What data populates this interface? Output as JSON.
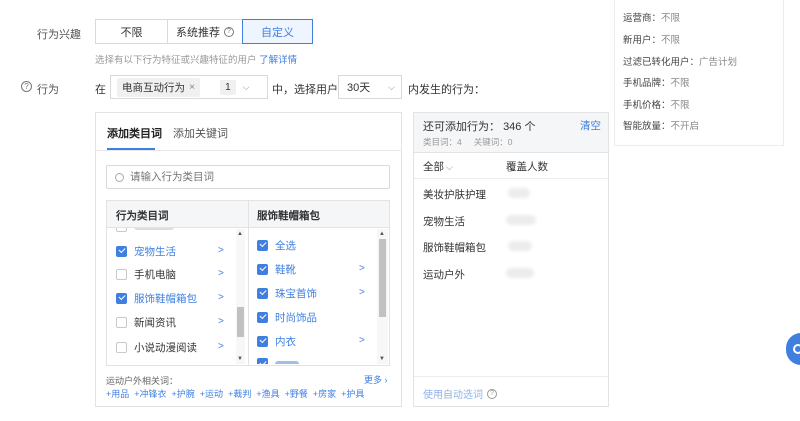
{
  "interest": {
    "label": "行为兴趣",
    "options": [
      "不限",
      "系统推荐",
      "自定义"
    ],
    "selected": "自定义",
    "hint": "选择有以下行为特征或兴趣特征的用户",
    "hint_link": "了解详情"
  },
  "behavior": {
    "label": "行为",
    "prefix": "在",
    "scene_tag": "电商互动行为",
    "count": "1",
    "mid_text": "中，选择用户",
    "days": "30天",
    "suffix": "内发生的行为："
  },
  "left_panel": {
    "tabs": [
      "添加类目词",
      "添加关键词"
    ],
    "search_placeholder": "请输入行为类目词",
    "col1_header": "行为类目词",
    "col2_header": "服饰鞋帽箱包",
    "col1_items": [
      {
        "label": "宠物生活",
        "checked": true
      },
      {
        "label": "手机电脑",
        "checked": false
      },
      {
        "label": "服饰鞋帽箱包",
        "checked": true
      },
      {
        "label": "新闻资讯",
        "checked": false
      },
      {
        "label": "小说动漫阅读",
        "checked": false
      }
    ],
    "col2_items": [
      {
        "label": "全选",
        "checked": true,
        "arrow": false
      },
      {
        "label": "鞋靴",
        "checked": true,
        "arrow": true
      },
      {
        "label": "珠宝首饰",
        "checked": true,
        "arrow": true
      },
      {
        "label": "时尚饰品",
        "checked": true,
        "arrow": false
      },
      {
        "label": "内衣",
        "checked": true,
        "arrow": true
      }
    ],
    "related_title": "运动户外相关词：",
    "related_more": "更多",
    "related_words": [
      "+用品",
      "+冲锋衣",
      "+护腕",
      "+运动",
      "+裁判",
      "+渔具",
      "+野餐",
      "+房家",
      "+护具"
    ]
  },
  "right_panel": {
    "title": "还可添加行为：",
    "count_value": "346",
    "count_unit": "个",
    "clear": "清空",
    "sub_cat": "类目词：4",
    "sub_kw": "关键词：0",
    "col_all": "全部",
    "col_cover": "覆盖人数",
    "rows": [
      "美妆护肤护理",
      "宠物生活",
      "服饰鞋帽箱包",
      "运动户外"
    ],
    "footer": "使用自动选词"
  },
  "summary": {
    "items": [
      {
        "key": "运营商：",
        "val": "不限"
      },
      {
        "key": "新用户：",
        "val": "不限"
      },
      {
        "key": "过滤已转化用户：",
        "val": "广告计划"
      },
      {
        "key": "手机品牌：",
        "val": "不限"
      },
      {
        "key": "手机价格：",
        "val": "不限"
      },
      {
        "key": "智能放量：",
        "val": "不开启"
      }
    ]
  },
  "colors": {
    "accent": "#3f7fe0",
    "border": "#e3e3e3"
  }
}
